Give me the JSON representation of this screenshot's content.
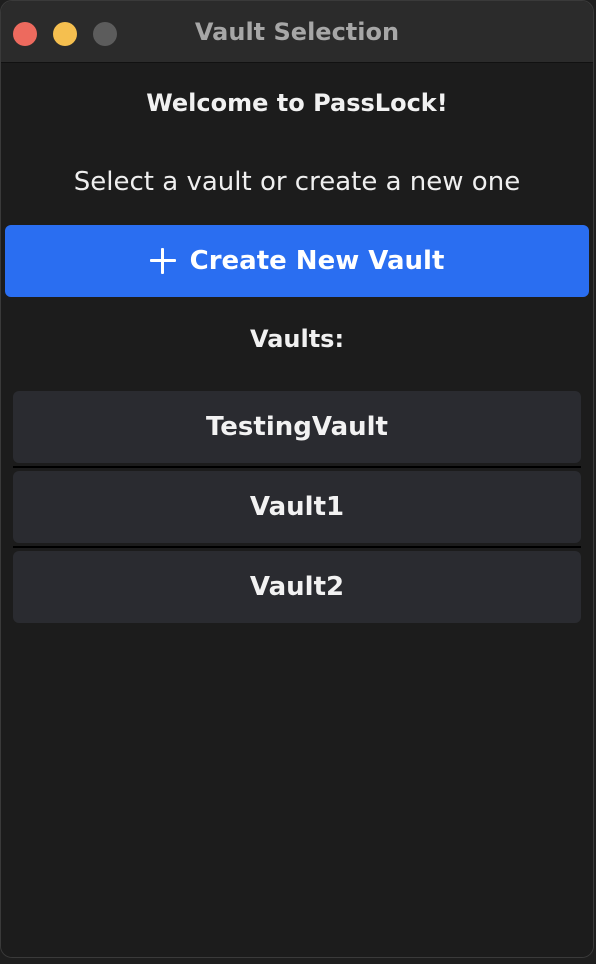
{
  "window": {
    "title": "Vault Selection",
    "traffic_lights": {
      "close_color": "#ed6a5e",
      "minimize_color": "#f5bf4f",
      "zoom_color": "#5c5c5c"
    }
  },
  "main": {
    "welcome": "Welcome to PassLock!",
    "subtitle": "Select a vault or create a new one",
    "create_button": {
      "icon": "plus-icon",
      "label": "Create New Vault",
      "color": "#2a6ef1"
    },
    "vaults_heading": "Vaults:",
    "vaults": [
      {
        "label": "TestingVault"
      },
      {
        "label": "Vault1"
      },
      {
        "label": "Vault2"
      }
    ]
  }
}
